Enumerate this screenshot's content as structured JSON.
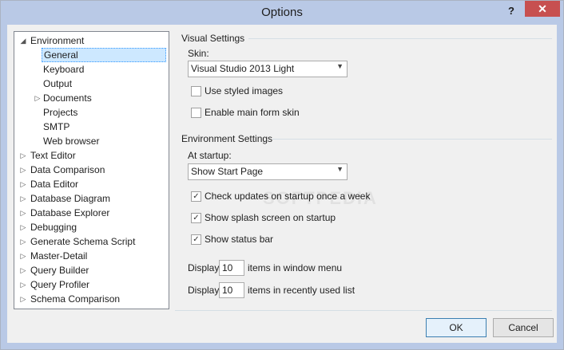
{
  "window": {
    "title": "Options",
    "help_glyph": "?",
    "close_glyph": "✕"
  },
  "tree": {
    "root": "Environment",
    "children": [
      "General",
      "Keyboard",
      "Output",
      "Documents",
      "Projects",
      "SMTP",
      "Web browser"
    ],
    "sections": [
      "Text Editor",
      "Data Comparison",
      "Data Editor",
      "Database Diagram",
      "Database Explorer",
      "Debugging",
      "Generate Schema Script",
      "Master-Detail",
      "Query Builder",
      "Query Profiler",
      "Schema Comparison"
    ]
  },
  "visual_settings": {
    "title": "Visual Settings",
    "skin_label": "Skin:",
    "skin_value": "Visual Studio 2013 Light",
    "use_styled_images": "Use styled images",
    "enable_main_form_skin": "Enable main form skin"
  },
  "environment_settings": {
    "title": "Environment Settings",
    "startup_label": "At startup:",
    "startup_value": "Show Start Page",
    "check_updates": "Check updates on startup once a week",
    "show_splash": "Show splash screen on startup",
    "show_status_bar": "Show status bar",
    "display_label": "Display",
    "window_menu_count": "10",
    "window_menu_suffix": "items in window menu",
    "recent_count": "10",
    "recent_suffix": "items in recently used list"
  },
  "buttons": {
    "ok": "OK",
    "cancel": "Cancel"
  },
  "watermark": "SOFTPEDIA",
  "colors": {
    "titlebar": "#b9c9e6",
    "close": "#c75050",
    "selection": "#cde8ff"
  }
}
